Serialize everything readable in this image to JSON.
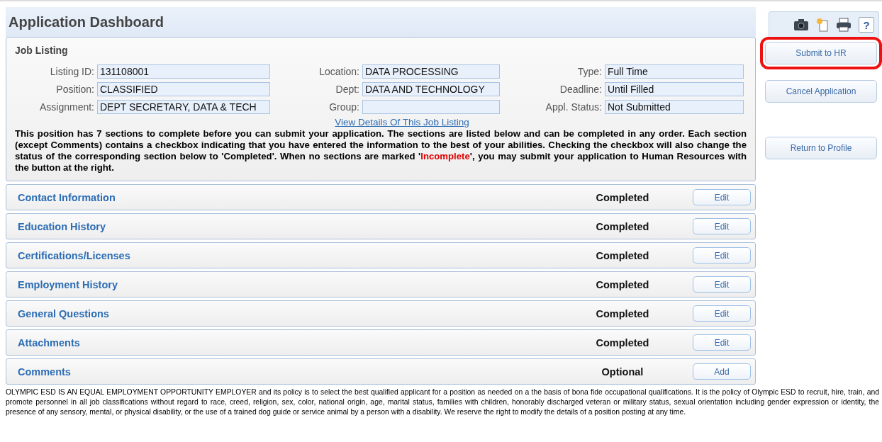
{
  "header": {
    "title": "Application Dashboard"
  },
  "toolbar": [
    {
      "kind": "camera"
    },
    {
      "kind": "new"
    },
    {
      "kind": "print"
    },
    {
      "kind": "help",
      "label": "?"
    }
  ],
  "actions": [
    {
      "label": "Submit to HR",
      "highlighted": true
    },
    {
      "label": "Cancel Application",
      "highlighted": false
    },
    {
      "label": "Return to Profile",
      "highlighted": false
    }
  ],
  "job_listing": {
    "title": "Job Listing",
    "fields": [
      {
        "label": "Listing ID:",
        "value": "131108001"
      },
      {
        "label": "Location:",
        "value": "DATA PROCESSING"
      },
      {
        "label": "Type:",
        "value": "Full Time"
      },
      {
        "label": "Position:",
        "value": "CLASSIFIED"
      },
      {
        "label": "Dept:",
        "value": "DATA AND TECHNOLOGY"
      },
      {
        "label": "Deadline:",
        "value": "Until Filled"
      },
      {
        "label": "Assignment:",
        "value": "DEPT SECRETARY, DATA & TECH"
      },
      {
        "label": "Group:"
      },
      {
        "label": "Appl. Status:",
        "value": "Not Submitted"
      }
    ],
    "link": "View Details Of This Job Listing",
    "intro": {
      "before": "This position has 7 sections to complete before you can submit your application. The sections are listed below and can be completed in any order. Each section (except Comments) contains a checkbox indicating that you have entered the information to the best of your abilities. Checking the checkbox will also change the status of the corresponding section below to 'Completed'. When no sections are marked '",
      "warning": "Incomplete",
      "after": "', you may submit your application to Human Resources with the button at the right."
    }
  },
  "sections": [
    {
      "name": "Contact Information",
      "status": "Completed",
      "action": "Edit"
    },
    {
      "name": "Education History",
      "status": "Completed",
      "action": "Edit"
    },
    {
      "name": "Certifications/Licenses",
      "status": "Completed",
      "action": "Edit"
    },
    {
      "name": "Employment History",
      "status": "Completed",
      "action": "Edit"
    },
    {
      "name": "General Questions",
      "status": "Completed",
      "action": "Edit"
    },
    {
      "name": "Attachments",
      "status": "Completed",
      "action": "Edit"
    },
    {
      "name": "Comments",
      "status": "Optional",
      "action": "Add"
    }
  ],
  "footer": "OLYMPIC ESD IS AN EQUAL EMPLOYMENT OPPORTUNITY EMPLOYER and its policy is to select the best qualified applicant for a position as needed on a the basis of bona fide occupational qualifications. It is the policy of Olympic ESD to recruit, hire, train, and promote personnel in all job classifications without regard to race, creed, religion, sex, color, national origin, age, marital status, families with children, honorably discharged veteran or military status, sexual orientation including gender expression or identity, the presence of any sensory, mental, or physical disability, or the use of a trained dog guide or service animal by a person with a disability. We reserve the right to modify the details of a position posting at any time."
}
